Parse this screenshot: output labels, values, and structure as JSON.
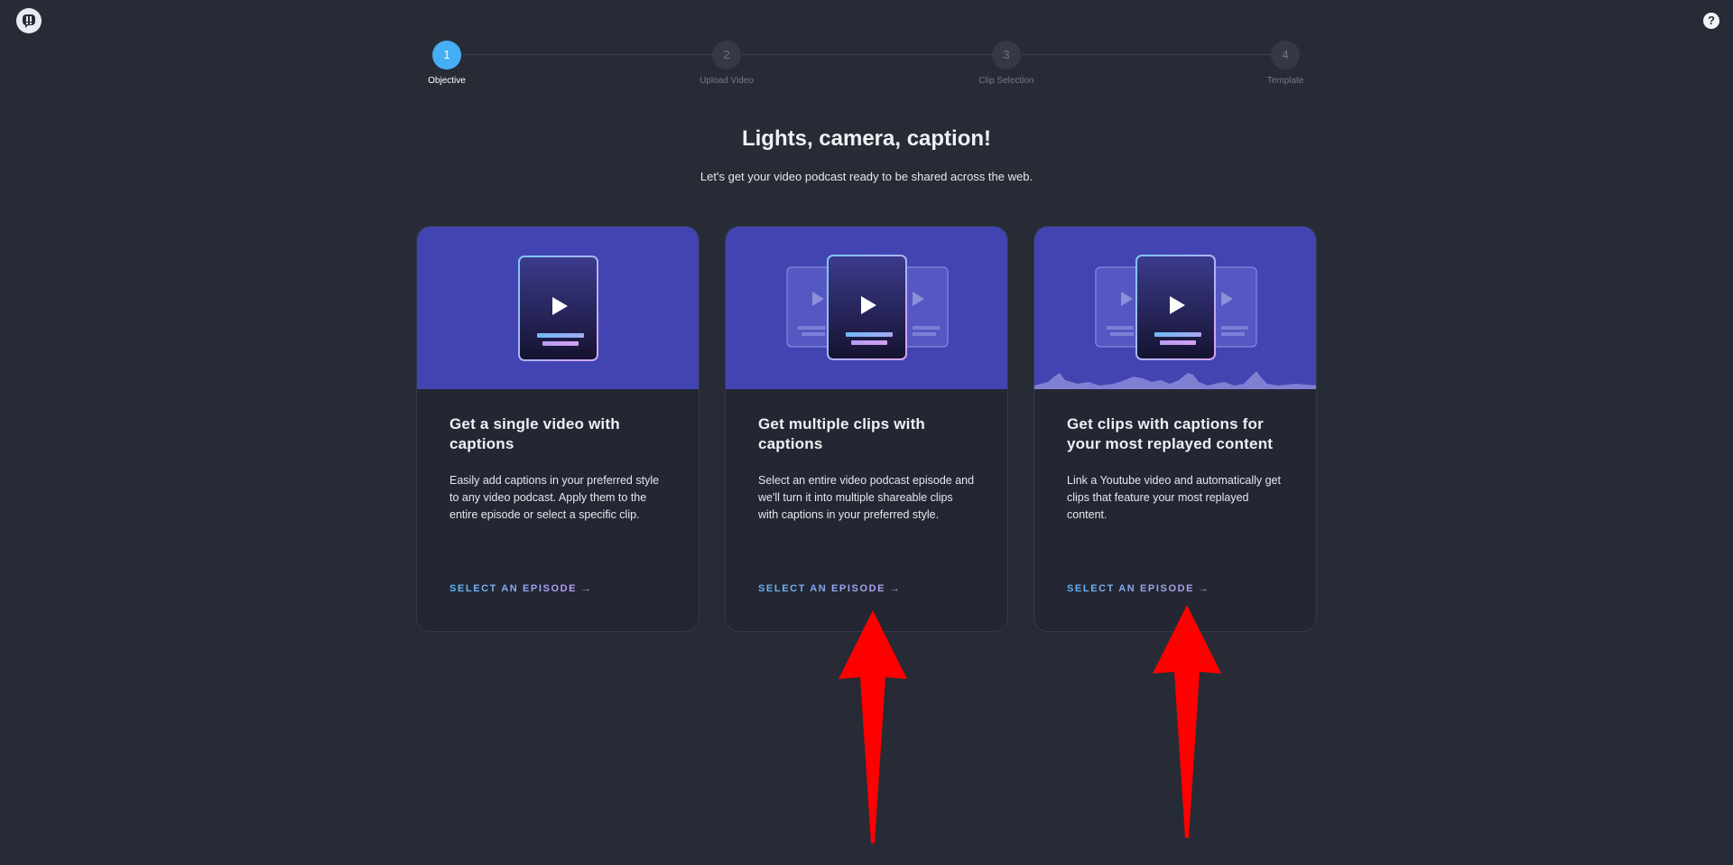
{
  "app": {
    "logo_icon": "app-logo-icon",
    "help_icon": "help-icon",
    "help_glyph": "?"
  },
  "stepper": {
    "active_color": "#45aef5",
    "steps": [
      {
        "number": "1",
        "label": "Objective",
        "active": true
      },
      {
        "number": "2",
        "label": "Upload Video",
        "active": false
      },
      {
        "number": "3",
        "label": "Clip Selection",
        "active": false
      },
      {
        "number": "4",
        "label": "Template",
        "active": false
      }
    ]
  },
  "header": {
    "title": "Lights, camera, caption!",
    "subtitle": "Let's get your video podcast ready to be shared across the web."
  },
  "cards": [
    {
      "illustration": "single-video-illustration",
      "title": "Get a single video with captions",
      "description": "Easily add captions in your preferred style to any video podcast. Apply them to the entire episode or select a specific clip.",
      "cta": "SELECT AN EPISODE →"
    },
    {
      "illustration": "multiple-clips-illustration",
      "title": "Get multiple clips with captions",
      "description": "Select an entire video podcast episode and we'll turn it into multiple shareable clips with captions in your preferred style.",
      "cta": "SELECT AN EPISODE →"
    },
    {
      "illustration": "replayed-clips-illustration",
      "title": "Get clips with captions for your most replayed content",
      "description": "Link a Youtube video and automatically get clips that feature your most replayed content.",
      "cta": "SELECT AN EPISODE →"
    }
  ],
  "colors": {
    "background": "#272b35",
    "card_background": "#232733",
    "hero_background": "#4244b2",
    "annotation_arrow": "#ff0000"
  }
}
